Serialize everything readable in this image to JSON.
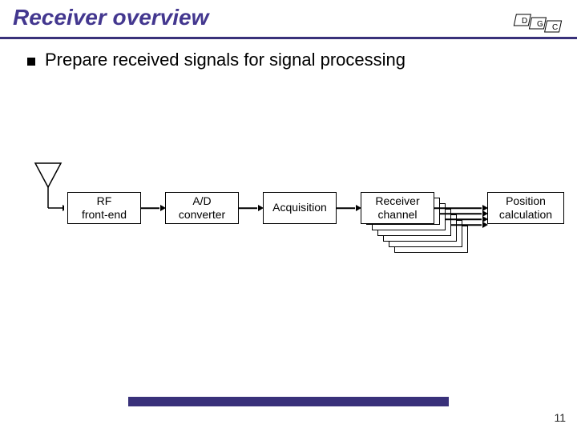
{
  "title": "Receiver overview",
  "bullet": "Prepare received signals for signal processing",
  "blocks": {
    "rf": "RF\nfront-end",
    "ad": "A/D\nconverter",
    "acq": "Acquisition",
    "chan": "Receiver\nchannel",
    "chan_rep": "channel",
    "pos": "Position\ncalculation"
  },
  "logo_glyphs": [
    "D",
    "G",
    "C"
  ],
  "page_number": "11"
}
